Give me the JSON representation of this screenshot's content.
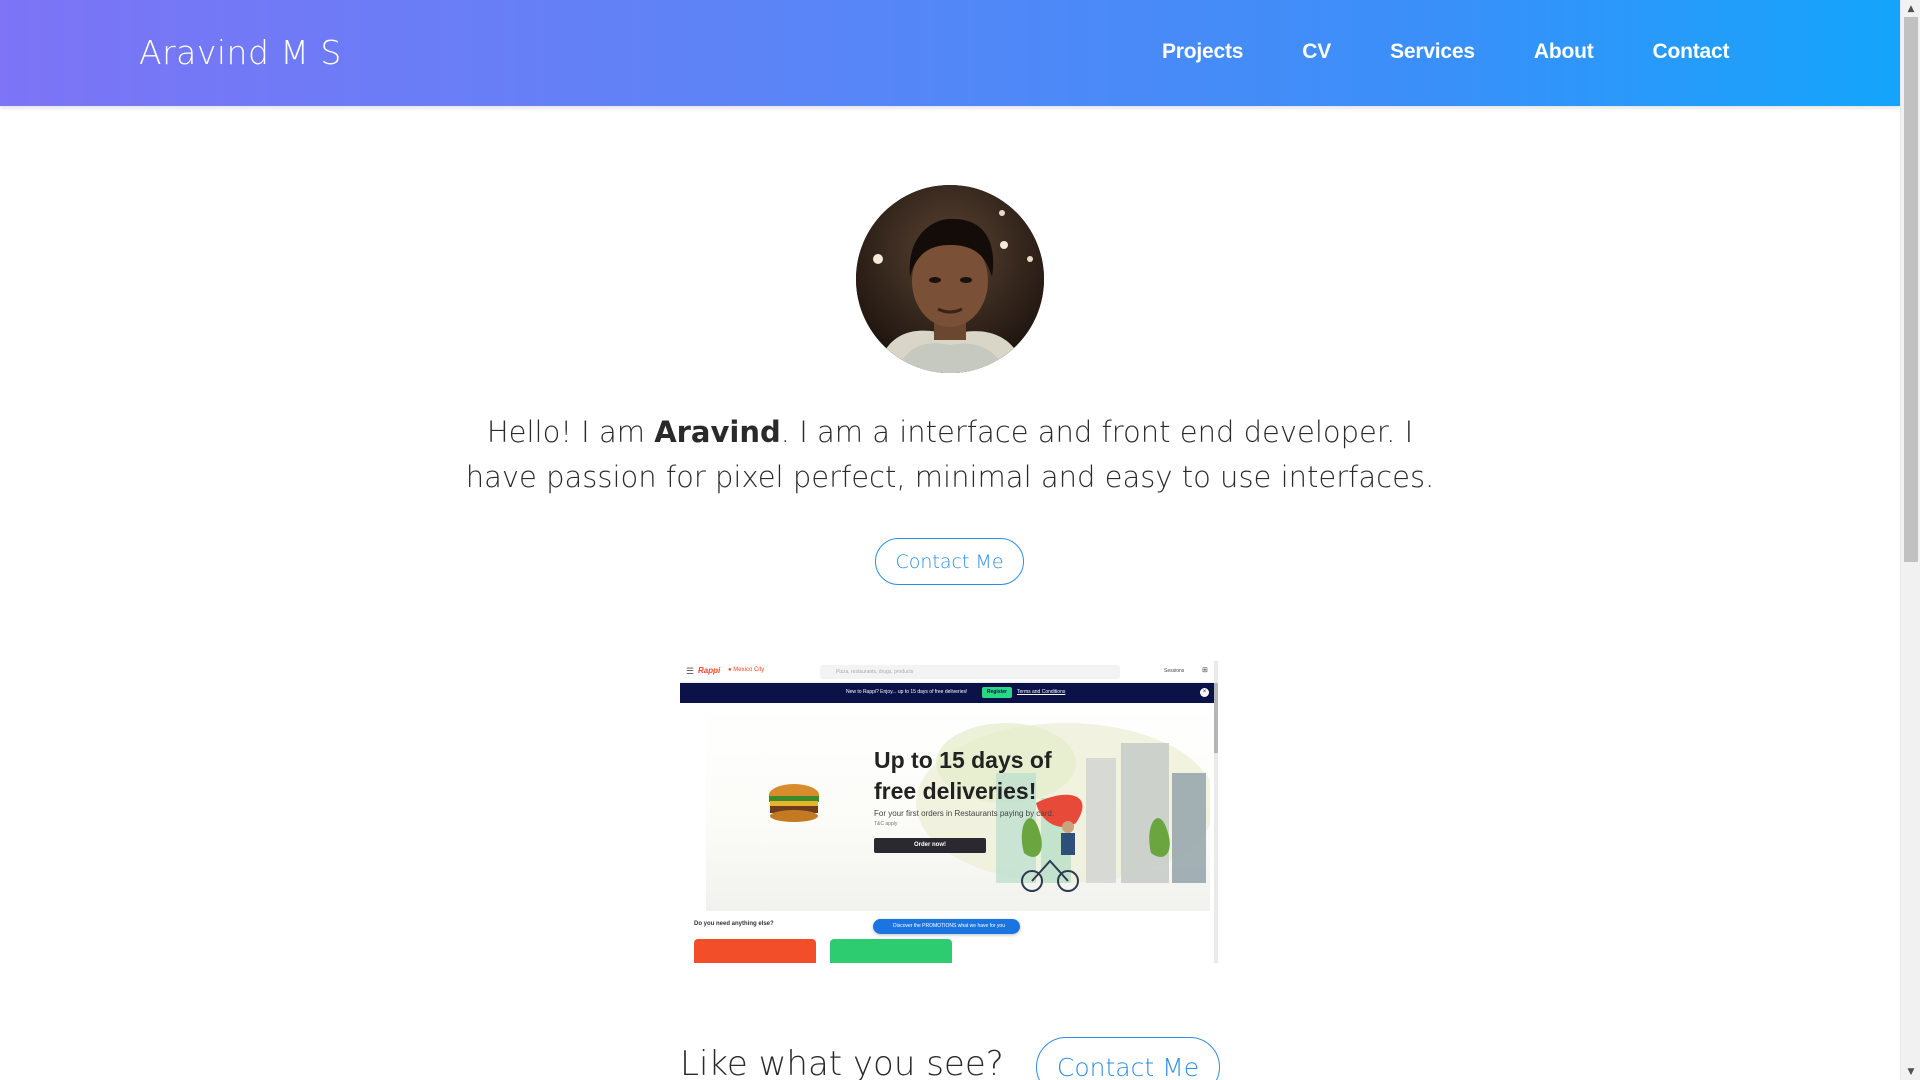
{
  "header": {
    "brand": "Aravind M S",
    "nav": [
      "Projects",
      "CV",
      "Services",
      "About",
      "Contact"
    ]
  },
  "hero": {
    "avatar_icon": "profile-photo",
    "intro_before": "Hello! I am ",
    "intro_name": "Aravind",
    "intro_after": ". I am a interface and front end developer. I have passion for pixel perfect, minimal and easy to use interfaces.",
    "button_label": "Contact Me"
  },
  "project_preview": {
    "logo": "Rappi",
    "city": "Mexico City",
    "search_placeholder": "Pizza, restaurants, drugs, products",
    "signin": "Sessions",
    "banner_text": "New to Rappi? Enjoy... up to 15 days of free deliveries!",
    "register_label": "Register",
    "terms_label": "Terms and Conditions",
    "heading": "Up to 15 days of free deliveries!",
    "subtext": "For your first orders in Restaurants paying by card.",
    "terms_small": "T&C apply",
    "order_label": "Order now!",
    "need_label": "Do you need anything else?",
    "promo_label": "Discover the PROMOTIONS what we have for you"
  },
  "cta": {
    "text": "Like what you see?",
    "button_label": "Contact Me"
  },
  "colors": {
    "header_gradient_start": "#7d74f6",
    "header_gradient_end": "#14a5fb",
    "accent": "#2e8fe2",
    "text": "#2a2a2a"
  }
}
